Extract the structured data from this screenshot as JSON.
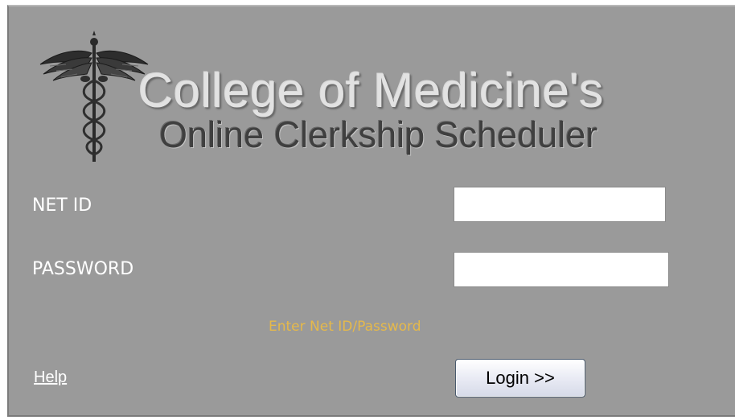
{
  "header": {
    "title_line1": "College of Medicine's",
    "title_line2": "Online Clerkship Scheduler",
    "logo_icon": "caduceus-icon"
  },
  "form": {
    "netid_label": "NET ID",
    "netid_value": "",
    "password_label": "PASSWORD",
    "password_value": "",
    "message": "Enter Net ID/Password",
    "help_label": "Help",
    "login_label": "Login >>"
  },
  "colors": {
    "panel_background": "#9a9a9a",
    "message_text": "#e6b94a",
    "label_text": "#ffffff"
  }
}
